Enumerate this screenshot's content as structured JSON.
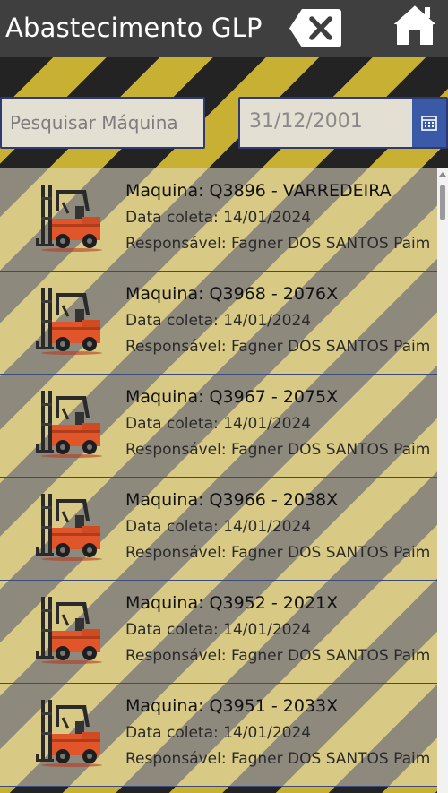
{
  "header": {
    "title": "Abastecimento GLP",
    "clear_icon": "backspace-x-icon",
    "home_icon": "home-icon"
  },
  "search": {
    "placeholder": "Pesquisar Máquina",
    "value": ""
  },
  "date_filter": {
    "value": "31/12/2001",
    "icon": "calendar-icon"
  },
  "colors": {
    "header_bg": "#3f3f3f",
    "stripe_dark": "#232323",
    "stripe_yellow": "#c8b032",
    "calendar_btn": "#3a5aa8",
    "field_border": "#2f3b6e"
  },
  "records": [
    {
      "machine": "Maquina: Q3896 - VARREDEIRA",
      "date": "Data coleta: 14/01/2024",
      "responsible": "Responsável: Fagner DOS SANTOS Paim",
      "icon": "forklift-icon"
    },
    {
      "machine": "Maquina: Q3968 - 2076X",
      "date": "Data coleta: 14/01/2024",
      "responsible": "Responsável: Fagner DOS SANTOS Paim",
      "icon": "forklift-icon"
    },
    {
      "machine": "Maquina: Q3967 - 2075X",
      "date": "Data coleta: 14/01/2024",
      "responsible": "Responsável: Fagner DOS SANTOS Paim",
      "icon": "forklift-icon"
    },
    {
      "machine": "Maquina: Q3966 - 2038X",
      "date": "Data coleta: 14/01/2024",
      "responsible": "Responsável: Fagner DOS SANTOS Paim",
      "icon": "forklift-icon"
    },
    {
      "machine": "Maquina: Q3952 - 2021X",
      "date": "Data coleta: 14/01/2024",
      "responsible": "Responsável: Fagner DOS SANTOS Paim",
      "icon": "forklift-icon"
    },
    {
      "machine": "Maquina: Q3951 - 2033X",
      "date": "Data coleta: 14/01/2024",
      "responsible": "Responsável: Fagner DOS SANTOS Paim",
      "icon": "forklift-icon"
    }
  ]
}
